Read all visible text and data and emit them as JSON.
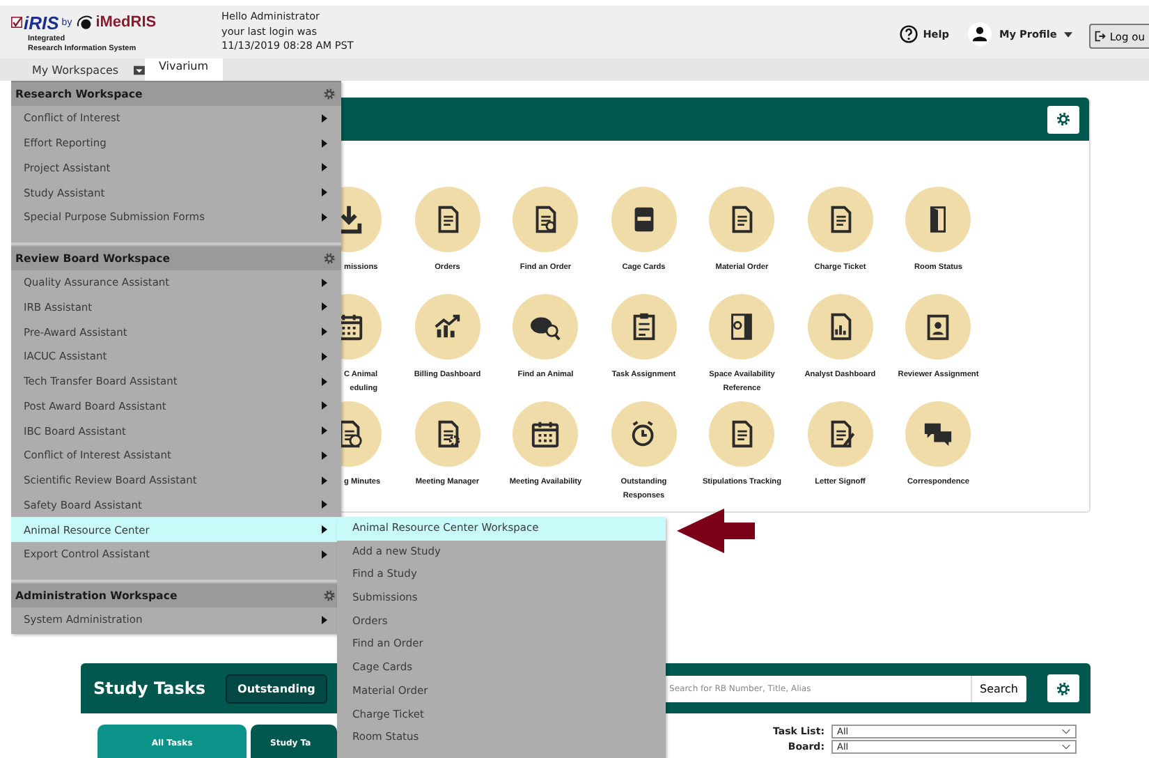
{
  "header": {
    "logo": {
      "product": "iRIS",
      "by": "by",
      "vendor": "iMedRIS",
      "tagline_1": "Integrated",
      "tagline_2": "Research Information System"
    },
    "greeting": [
      "Hello Administrator",
      "your last login was",
      "11/13/2019 08:28 AM PST"
    ],
    "help": "Help",
    "profile": "My Profile",
    "logout": "Log ou"
  },
  "nav": {
    "workspaces": "My Workspaces",
    "tab": "Vivarium"
  },
  "panel": {
    "tiles": [
      {
        "label": "missions",
        "kind": "clipped"
      },
      {
        "label": "Orders",
        "kind": "full"
      },
      {
        "label": "Find an Order",
        "kind": "full"
      },
      {
        "label": "Cage Cards",
        "kind": "full"
      },
      {
        "label": "Material Order",
        "kind": "full"
      },
      {
        "label": "Charge Ticket",
        "kind": "full"
      },
      {
        "label": "Room Status",
        "kind": "full"
      },
      {
        "label": "C Animal\neduling",
        "kind": "clipped"
      },
      {
        "label": "Billing Dashboard",
        "kind": "full"
      },
      {
        "label": "Find an Animal",
        "kind": "full"
      },
      {
        "label": "Task Assignment",
        "kind": "full"
      },
      {
        "label": "Space Availability Reference",
        "kind": "full"
      },
      {
        "label": "Analyst Dashboard",
        "kind": "full"
      },
      {
        "label": "Reviewer Assignment",
        "kind": "full"
      },
      {
        "label": "g Minutes",
        "kind": "clipped"
      },
      {
        "label": "Meeting Manager",
        "kind": "full"
      },
      {
        "label": "Meeting Availability",
        "kind": "full"
      },
      {
        "label": "Outstanding Responses",
        "kind": "full"
      },
      {
        "label": "Stipulations Tracking",
        "kind": "full"
      },
      {
        "label": "Letter Signoff",
        "kind": "full"
      },
      {
        "label": "Correspondence",
        "kind": "full"
      }
    ]
  },
  "study_tasks": {
    "title": "Study Tasks",
    "filter": "Outstanding",
    "search": {
      "placeholder": "Search for RB Number, Title, Alias"
    },
    "search_button": "Search",
    "tabs": [
      {
        "label": "All Tasks",
        "selected": true
      },
      {
        "label": "Study Ta",
        "selected": false
      }
    ],
    "task_list": {
      "label": "Task List:",
      "value": "All"
    },
    "board": {
      "label": "Board:",
      "value": "All"
    }
  },
  "workspace_menu": {
    "sections": [
      {
        "title": "Research Workspace",
        "items": [
          {
            "label": "Conflict of Interest",
            "selected": false
          },
          {
            "label": "Effort Reporting",
            "selected": false
          },
          {
            "label": "Project Assistant",
            "selected": false
          },
          {
            "label": "Study Assistant",
            "selected": false
          },
          {
            "label": "Special Purpose Submission Forms",
            "selected": false
          }
        ]
      },
      {
        "title": "Review Board Workspace",
        "items": [
          {
            "label": "Quality Assurance Assistant",
            "selected": false
          },
          {
            "label": "IRB Assistant",
            "selected": false
          },
          {
            "label": "Pre-Award Assistant",
            "selected": false
          },
          {
            "label": "IACUC Assistant",
            "selected": false
          },
          {
            "label": "Tech Transfer Board Assistant",
            "selected": false
          },
          {
            "label": "Post Award Board Assistant",
            "selected": false
          },
          {
            "label": "IBC Board Assistant",
            "selected": false
          },
          {
            "label": "Conflict of Interest Assistant",
            "selected": false
          },
          {
            "label": "Scientific Review Board Assistant",
            "selected": false
          },
          {
            "label": "Safety Board Assistant",
            "selected": false
          },
          {
            "label": "Animal Resource Center",
            "selected": true
          },
          {
            "label": "Export Control Assistant",
            "selected": false
          }
        ]
      },
      {
        "title": "Administration Workspace",
        "items": [
          {
            "label": "System Administration",
            "selected": false
          }
        ]
      }
    ]
  },
  "submenu": {
    "items": [
      {
        "label": "Animal Resource Center Workspace",
        "selected": true
      },
      {
        "label": "Add a new Study",
        "selected": false
      },
      {
        "label": "Find a Study",
        "selected": false
      },
      {
        "label": "Submissions",
        "selected": false
      },
      {
        "label": "Orders",
        "selected": false
      },
      {
        "label": "Find an Order",
        "selected": false
      },
      {
        "label": "Cage Cards",
        "selected": false
      },
      {
        "label": "Material Order",
        "selected": false
      },
      {
        "label": "Charge Ticket",
        "selected": false
      },
      {
        "label": "Room Status",
        "selected": false
      }
    ]
  }
}
